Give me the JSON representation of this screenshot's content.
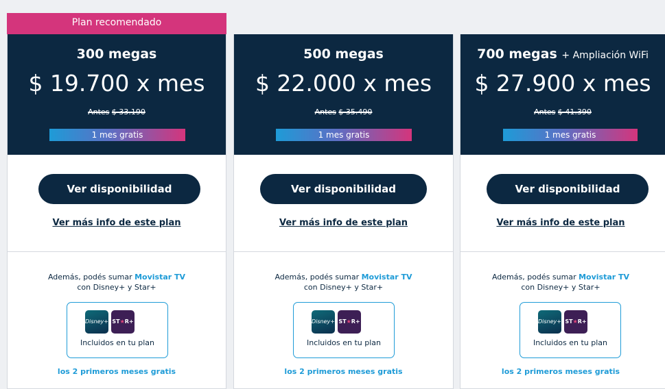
{
  "colors": {
    "navy": "#0c2841",
    "pink": "#d4357c",
    "blue": "#1e9bd7"
  },
  "badge": {
    "label": "Plan recomendado"
  },
  "plans": [
    {
      "name": "300 megas",
      "extra": "",
      "price": "$ 19.700 x mes",
      "before_label": "Antes",
      "before_price": "$ 33.190",
      "promo": "1 mes gratis",
      "cta": "Ver disponibilidad",
      "more": "Ver más info de este plan",
      "addon_text": "Además, podés sumar",
      "addon_brand": "Movistar TV",
      "addon_text2": "con Disney+ y Star+",
      "logo_disney": "Disney+",
      "logo_star_a": "ST",
      "logo_star_b": "★",
      "logo_star_c": "R+",
      "included": "Incluidos en tu plan",
      "gratis": "los 2 primeros meses gratis"
    },
    {
      "name": "500 megas",
      "extra": "",
      "price": "$ 22.000 x mes",
      "before_label": "Antes",
      "before_price": "$ 35.490",
      "promo": "1 mes gratis",
      "cta": "Ver disponibilidad",
      "more": "Ver más info de este plan",
      "addon_text": "Además, podés sumar",
      "addon_brand": "Movistar TV",
      "addon_text2": "con Disney+ y Star+",
      "logo_disney": "Disney+",
      "logo_star_a": "ST",
      "logo_star_b": "★",
      "logo_star_c": "R+",
      "included": "Incluidos en tu plan",
      "gratis": "los 2 primeros meses gratis"
    },
    {
      "name": "700 megas",
      "extra": "+ Ampliación WiFi",
      "price": "$ 27.900 x mes",
      "before_label": "Antes",
      "before_price": "$ 41.390",
      "promo": "1 mes gratis",
      "cta": "Ver disponibilidad",
      "more": "Ver más info de este plan",
      "addon_text": "Además, podés sumar",
      "addon_brand": "Movistar TV",
      "addon_text2": "con Disney+ y Star+",
      "logo_disney": "Disney+",
      "logo_star_a": "ST",
      "logo_star_b": "★",
      "logo_star_c": "R+",
      "included": "Incluidos en tu plan",
      "gratis": "los 2 primeros meses gratis"
    }
  ]
}
